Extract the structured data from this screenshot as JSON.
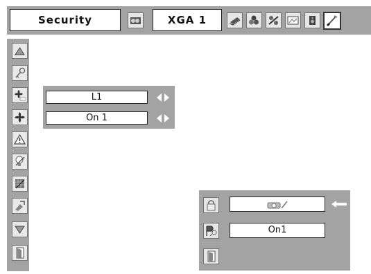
{
  "topbar": {
    "title": "Security",
    "input_source": "XGA 1",
    "icons": [
      "projector-input-icon",
      "laptop-icon",
      "color-adjust-icon",
      "image-adjust-icon",
      "screen-icon",
      "speaker-icon",
      "setting-icon"
    ]
  },
  "sidebar": {
    "items": [
      "up-arrow-icon",
      "key-icon",
      "fan-off-icon",
      "fan-icon",
      "warning-icon",
      "lamp-icon",
      "filter-icon",
      "logo-pin-icon",
      "down-arrow-icon",
      "exit-icon"
    ]
  },
  "lock_submenu": {
    "rows": [
      {
        "value": "L1"
      },
      {
        "value": "On 1"
      }
    ]
  },
  "security_panel": {
    "rows": [
      {
        "icon": "padlock-icon",
        "value": ""
      },
      {
        "icon": "pin-code-icon",
        "value": "On1"
      },
      {
        "icon": "exit-icon",
        "value": ""
      }
    ]
  },
  "colors": {
    "panel": "#a3a3a3",
    "field": "#ffffff"
  }
}
